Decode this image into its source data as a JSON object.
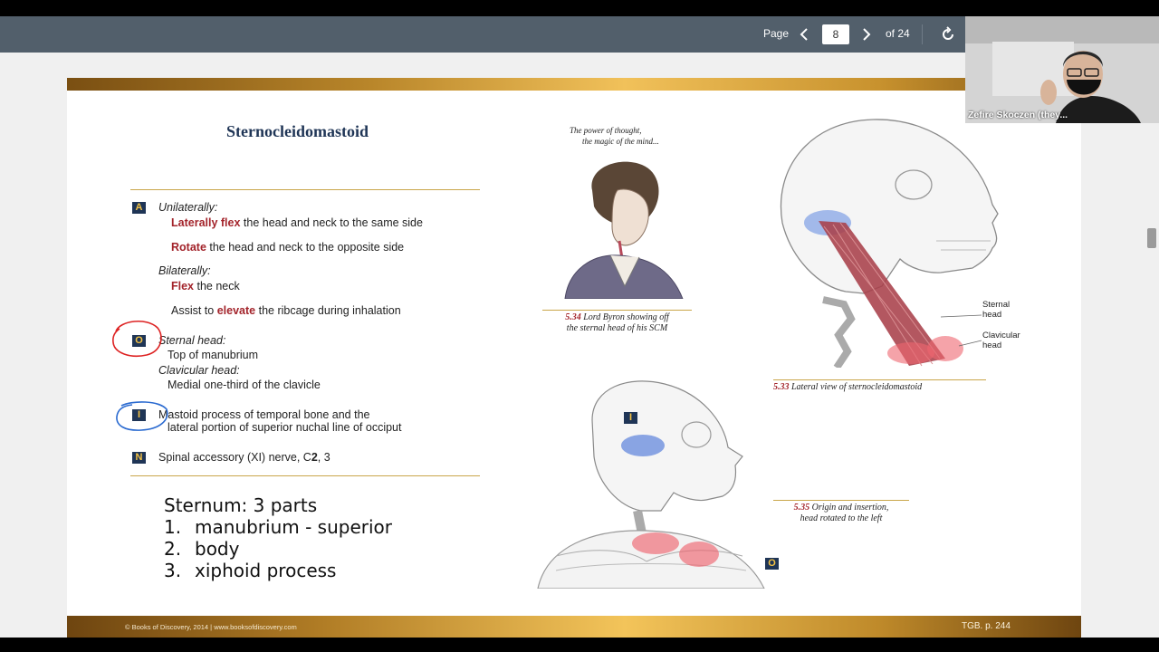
{
  "toolbar": {
    "page_label": "Page",
    "current_page": "8",
    "of_label": "of 24",
    "prev_icon": "chevron-left-icon",
    "next_icon": "chevron-right-icon",
    "refresh_icon": "rotate-icon"
  },
  "webcam": {
    "name": "Zefire Skoczen (they..."
  },
  "slide": {
    "title": "Sternocleidomastoid",
    "action_badge": "A",
    "unilaterally": "Unilaterally:",
    "line1_hl": "Laterally flex",
    "line1_rest": " the head and neck to the same side",
    "line2_hl": "Rotate",
    "line2_rest": " the head and neck to the opposite side",
    "bilaterally": "Bilaterally:",
    "line3_hl": "Flex",
    "line3_rest": " the neck",
    "line4_pre": "Assist to ",
    "line4_hl": "elevate",
    "line4_rest": " the ribcage during inhalation",
    "origin_badge": "O",
    "sternal_head": "Sternal head:",
    "sternal_detail": "Top of manubrium",
    "clavicular_head": "Clavicular head:",
    "clavicular_detail": "Medial one-third of the clavicle",
    "insertion_badge": "I",
    "insertion_line1": "Mastoid process of temporal bone and the",
    "insertion_line2": "lateral portion of superior nuchal line of occiput",
    "nerve_badge": "N",
    "nerve_pre": "Spinal accessory (XI) nerve, C",
    "nerve_bold": "2",
    "nerve_post": ", 3",
    "notes_heading": "Sternum: 3 parts",
    "notes": [
      {
        "n": "1.",
        "t": "manubrium - superior"
      },
      {
        "n": "2.",
        "t": "body"
      },
      {
        "n": "3.",
        "t": "xiphoid process"
      }
    ],
    "quote_line1": "The power of thought,",
    "quote_line2": "the magic of the mind...",
    "fig534_num": "5.34",
    "fig534_line1": " Lord Byron showing off",
    "fig534_line2": "the sternal head of his SCM",
    "fig533_num": "5.33",
    "fig533_text": " Lateral view of sternocleidomastoid",
    "fig535_num": "5.35",
    "fig535_line1": " Origin and insertion,",
    "fig535_line2": "head rotated to the left",
    "label_sternal_1": "Sternal",
    "label_sternal_2": "head",
    "label_clavicular_1": "Clavicular",
    "label_clavicular_2": "head",
    "fig_badge_i": "I",
    "fig_badge_o": "O",
    "footer_left": "© Books of Discovery, 2014 | www.booksofdiscovery.com",
    "footer_right": "TGB. p. 244"
  },
  "colors": {
    "toolbar": "#525f6b",
    "navy": "#1f3556",
    "badge_text": "#f3c245",
    "highlight": "#a3242b",
    "gold": "#c9a64a"
  }
}
